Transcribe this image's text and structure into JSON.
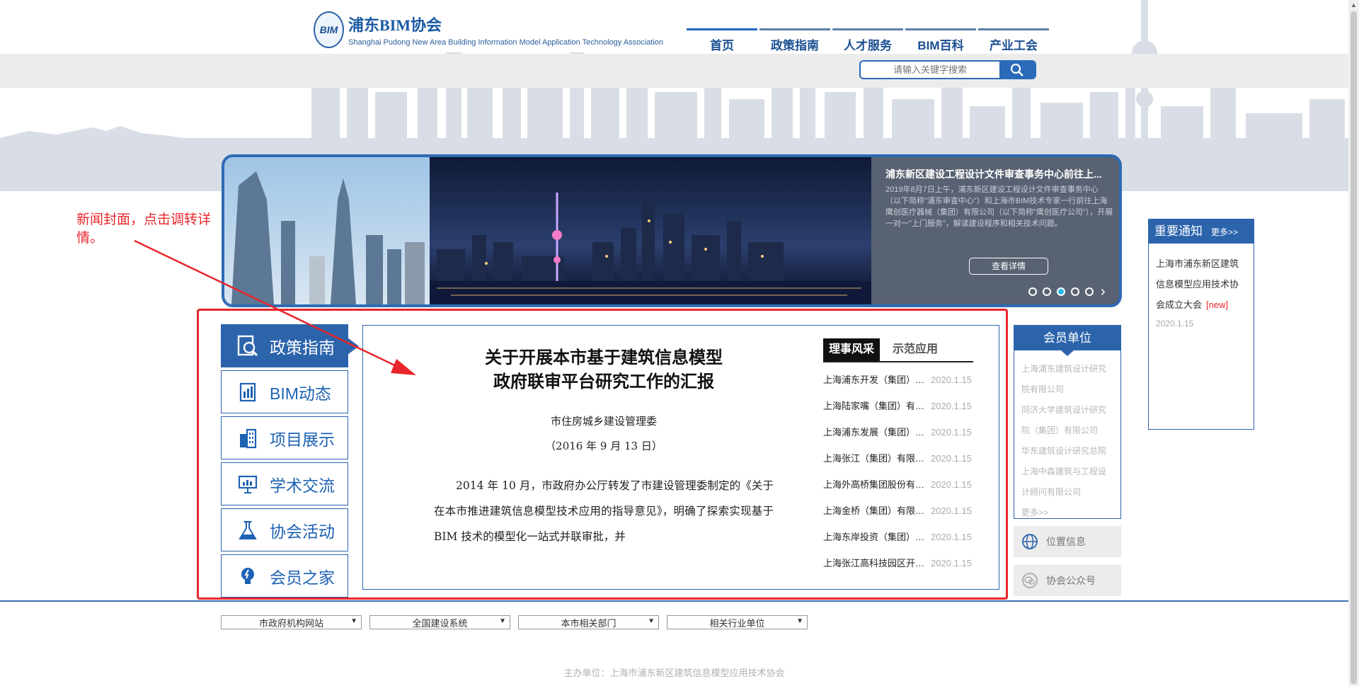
{
  "header": {
    "logo_mark": "BIM",
    "logo_title": "浦东BIM协会",
    "logo_subtitle": "Shanghai Pudong New Area Building Information Model Application Technology Association",
    "nav": [
      "首页",
      "政策指南",
      "人才服务",
      "BIM百科",
      "产业工会"
    ],
    "search_placeholder": "请输入关键字搜索"
  },
  "banner": {
    "title": "浦东新区建设工程设计文件审查事务中心前往上...",
    "summary": "2019年8月7日上午，浦东新区建设工程设计文件审查事务中心（以下简称\"浦东审查中心\"）和上海市BIM技术专家一行前往上海鹰创医疗器械（集团）有限公司（以下简称\"鹰创医疗公司\"），开展一对一\"上门服务\"，解读建设程序和相关技术问题。",
    "button": "查看详情",
    "slides": 5,
    "active_slide": 3
  },
  "annotation": {
    "text": "新闻封面，点击调转详情。",
    "color": "#e8262b"
  },
  "sidebar": {
    "items": [
      {
        "label": "政策指南",
        "icon": "search-document-icon"
      },
      {
        "label": "BIM动态",
        "icon": "report-icon"
      },
      {
        "label": "项目展示",
        "icon": "building-icon"
      },
      {
        "label": "学术交流",
        "icon": "presentation-icon"
      },
      {
        "label": "协会活动",
        "icon": "flask-icon"
      },
      {
        "label": "会员之家",
        "icon": "bulb-icon"
      }
    ]
  },
  "document": {
    "title_line1": "关于开展本市基于建筑信息模型",
    "title_line2": "政府联审平台研究工作的汇报",
    "org": "市住房城乡建设管理委",
    "date": "（2016 年 9 月 13 日）",
    "body": "2014 年 10 月，市政府办公厅转发了市建设管理委制定的《关于在本市推进建筑信息模型技术应用的指导意见》，明确了探索实现基于 BIM 技术的模型化一站式并联审批，并"
  },
  "news": {
    "tabs": [
      "理事风采",
      "示范应用"
    ],
    "items": [
      {
        "title": "上海浦东开发（集团）有限公司",
        "date": "2020.1.15"
      },
      {
        "title": "上海陆家嘴（集团）有限公司",
        "date": "2020.1.15"
      },
      {
        "title": "上海浦东发展（集团）有限公司",
        "date": "2020.1.15"
      },
      {
        "title": "上海张江（集团）有限公司",
        "date": "2020.1.15"
      },
      {
        "title": "上海外高桥集团股份有限公司",
        "date": "2020.1.15"
      },
      {
        "title": "上海金桥（集团）有限公司",
        "date": "2020.1.15"
      },
      {
        "title": "上海东岸投资（集团）有限公司",
        "date": "2020.1.15"
      },
      {
        "title": "上海张江高科技园区开发股份有限公司",
        "date": "2020.1.15"
      }
    ]
  },
  "members": {
    "title": "会员单位",
    "items": [
      "上海浦东建筑设计研究",
      "院有限公司",
      "同济大学建筑设计研究",
      "院（集团）有限公司",
      "华东建筑设计研究总院",
      "上海中森建筑与工程设",
      "计顾问有限公司",
      "更多>>"
    ]
  },
  "info_buttons": [
    {
      "label": "位置信息",
      "icon": "globe-icon"
    },
    {
      "label": "协会公众号",
      "icon": "wechat-icon"
    }
  ],
  "notice": {
    "title": "重要通知",
    "more": "更多>>",
    "text": "上海市浦东新区建筑信息模型应用技术协会成立大会",
    "new_tag": "[new]",
    "date": "2020.1.15"
  },
  "footer": {
    "selects": [
      "市政府机构网站",
      "全国建设系统",
      "本市相关部门",
      "相关行业单位"
    ],
    "copyright": "主办单位：上海市浦东新区建筑信息模型应用技术协会"
  }
}
